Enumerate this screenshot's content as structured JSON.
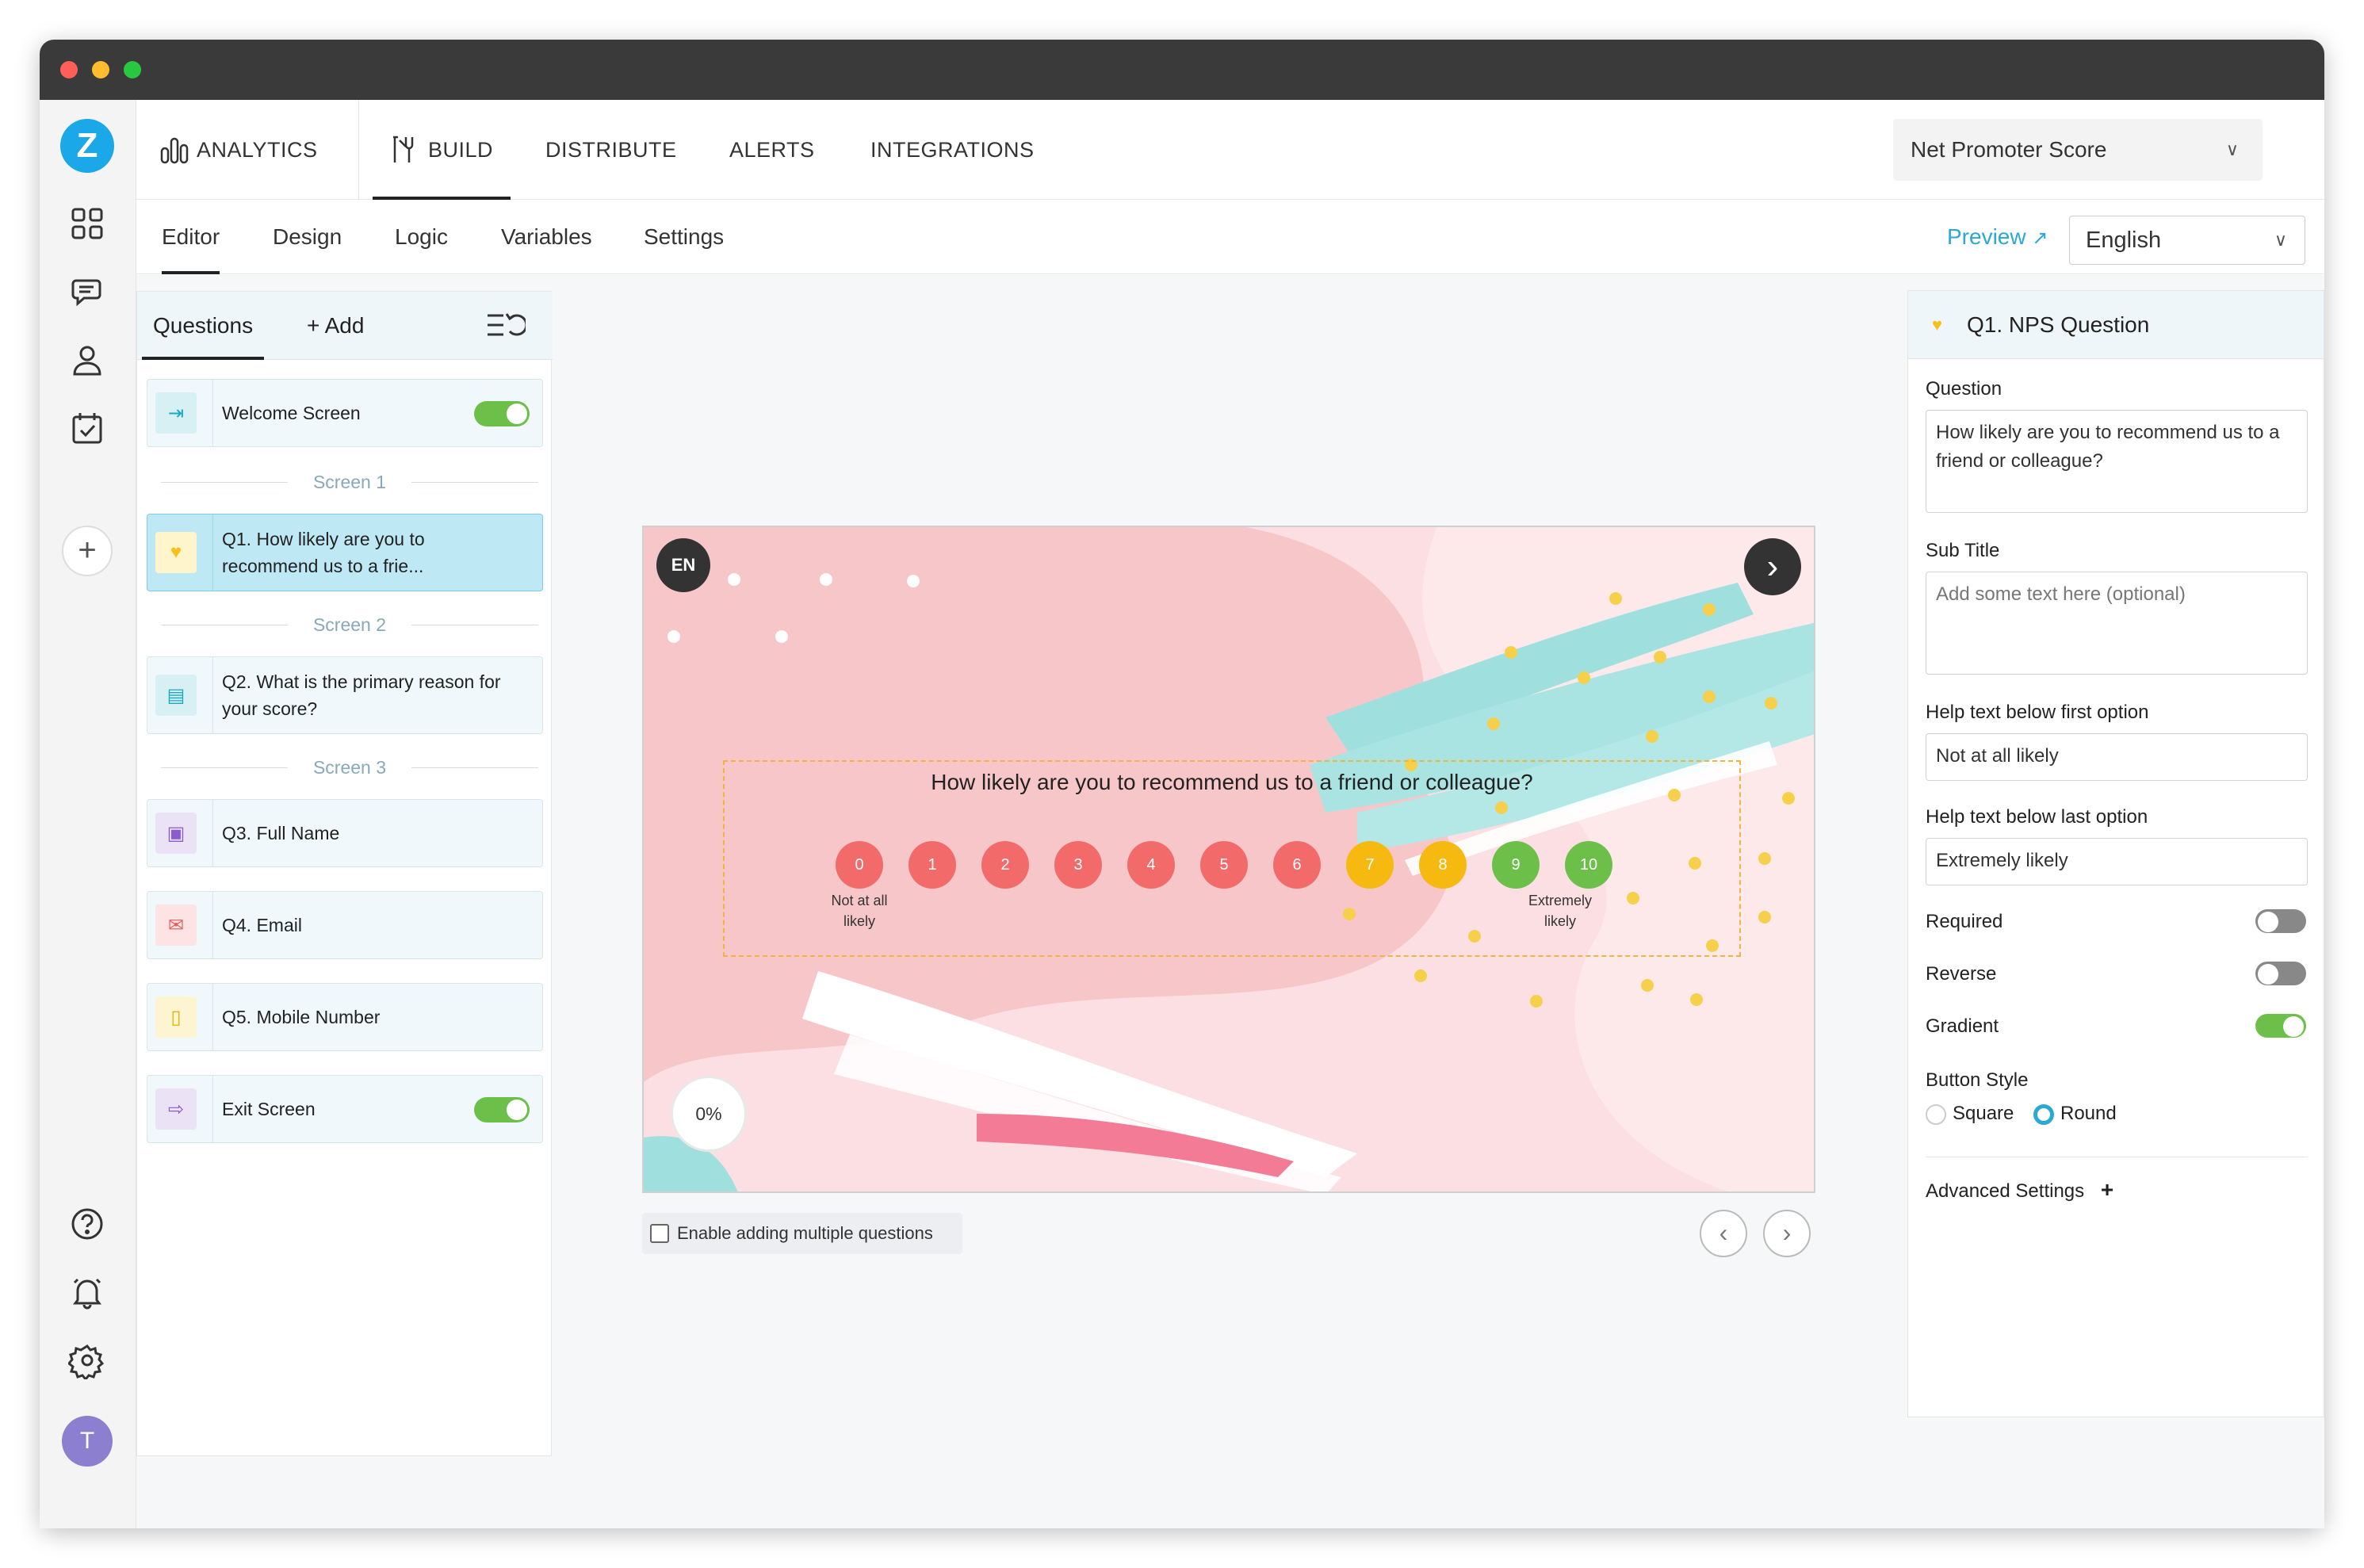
{
  "nav": {
    "analytics": "ANALYTICS",
    "build": "BUILD",
    "distribute": "DISTRIBUTE",
    "alerts": "ALERTS",
    "integrations": "INTEGRATIONS",
    "survey_name": "Net Promoter Score"
  },
  "subnav": {
    "editor": "Editor",
    "design": "Design",
    "logic": "Logic",
    "variables": "Variables",
    "settings": "Settings",
    "preview": "Preview",
    "language": "English"
  },
  "rail": {
    "logo": "Z",
    "avatar": "T"
  },
  "questions_panel": {
    "tab": "Questions",
    "add": "+ Add",
    "welcome": "Welcome Screen",
    "screen1": "Screen 1",
    "q1": "Q1. How likely are you to recommend us to a frie...",
    "screen2": "Screen 2",
    "q2": "Q2. What is the primary reason for your score?",
    "screen3": "Screen 3",
    "q3": "Q3. Full Name",
    "q4": "Q4. Email",
    "q5": "Q5. Mobile Number",
    "exit": "Exit Screen"
  },
  "preview": {
    "lang_badge": "EN",
    "question": "How likely are you to recommend us to a friend or colleague?",
    "scale": [
      "0",
      "1",
      "2",
      "3",
      "4",
      "5",
      "6",
      "7",
      "8",
      "9",
      "10"
    ],
    "scale_colors": [
      "#f26a6a",
      "#f26a6a",
      "#f26a6a",
      "#f26a6a",
      "#f26a6a",
      "#f26a6a",
      "#f26a6a",
      "#f5b90f",
      "#f5b90f",
      "#6cc04a",
      "#6cc04a"
    ],
    "help_first": "Not at all likely",
    "help_last": "Extremely likely",
    "progress": "0%",
    "multi_label": "Enable adding multiple questions"
  },
  "properties": {
    "title": "Q1. NPS Question",
    "question_label": "Question",
    "question_value": "How likely are you to recommend us to a friend or colleague?",
    "subtitle_label": "Sub Title",
    "subtitle_placeholder": "Add some text here (optional)",
    "help_first_label": "Help text below first option",
    "help_first_value": "Not at all likely",
    "help_last_label": "Help text below last option",
    "help_last_value": "Extremely likely",
    "required": "Required",
    "reverse": "Reverse",
    "gradient": "Gradient",
    "button_style": "Button Style",
    "square": "Square",
    "round": "Round",
    "advanced": "Advanced Settings"
  }
}
